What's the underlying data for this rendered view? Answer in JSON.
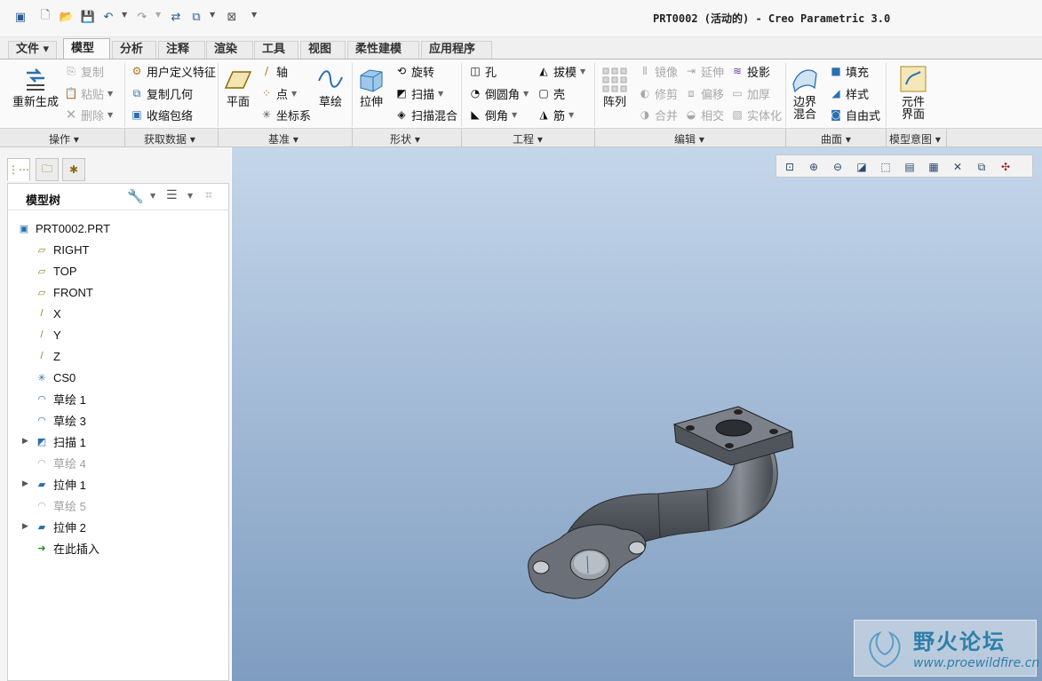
{
  "window": {
    "title": "PRT0002 (活动的) - Creo Parametric 3.0"
  },
  "tabs": [
    {
      "label": "文件 ▾",
      "active": false
    },
    {
      "label": "模型",
      "active": true
    },
    {
      "label": "分析",
      "active": false
    },
    {
      "label": "注释",
      "active": false
    },
    {
      "label": "渲染",
      "active": false
    },
    {
      "label": "工具",
      "active": false
    },
    {
      "label": "视图",
      "active": false
    },
    {
      "label": "柔性建模",
      "active": false
    },
    {
      "label": "应用程序",
      "active": false
    }
  ],
  "ribbon": {
    "regenerate": "重新生成",
    "copy": "复制",
    "paste": "粘贴",
    "delete": "删除",
    "udf": "用户定义特征",
    "copy_geometry": "复制几何",
    "shrinkwrap": "收缩包络",
    "plane": "平面",
    "axis": "轴",
    "point": "点",
    "csys": "坐标系",
    "sketch": "草绘",
    "extrude": "拉伸",
    "revolve": "旋转",
    "sweep": "扫描",
    "swept_blend": "扫描混合",
    "hole": "孔",
    "round": "倒圆角",
    "chamfer": "倒角",
    "draft": "拔模",
    "shell": "壳",
    "rib": "筋",
    "pattern": "阵列",
    "mirror": "镜像",
    "trim": "修剪",
    "merge": "合并",
    "extend": "延伸",
    "offset": "偏移",
    "intersect": "相交",
    "project": "投影",
    "thicken": "加厚",
    "solidify": "实体化",
    "boundary_blend_1": "边界",
    "boundary_blend_2": "混合",
    "fill": "填充",
    "style": "样式",
    "freestyle": "自由式",
    "component_interface_1": "元件",
    "component_interface_2": "界面"
  },
  "groups": [
    {
      "label": "操作 ▾"
    },
    {
      "label": "获取数据 ▾"
    },
    {
      "label": "基准 ▾"
    },
    {
      "label": "形状 ▾"
    },
    {
      "label": "工程 ▾"
    },
    {
      "label": "编辑 ▾"
    },
    {
      "label": "曲面 ▾"
    },
    {
      "label": "模型意图 ▾"
    }
  ],
  "model_tree": {
    "title": "模型树",
    "nodes": [
      {
        "label": "PRT0002.PRT",
        "icon": "part-icon",
        "dim": false,
        "expandable": false
      },
      {
        "label": "RIGHT",
        "icon": "datum-plane-icon",
        "dim": false,
        "expandable": false
      },
      {
        "label": "TOP",
        "icon": "datum-plane-icon",
        "dim": false,
        "expandable": false
      },
      {
        "label": "FRONT",
        "icon": "datum-plane-icon",
        "dim": false,
        "expandable": false
      },
      {
        "label": "X",
        "icon": "datum-axis-icon",
        "dim": false,
        "expandable": false
      },
      {
        "label": "Y",
        "icon": "datum-axis-icon",
        "dim": false,
        "expandable": false
      },
      {
        "label": "Z",
        "icon": "datum-axis-icon",
        "dim": false,
        "expandable": false
      },
      {
        "label": "CS0",
        "icon": "csys-icon",
        "dim": false,
        "expandable": false
      },
      {
        "label": "草绘 1",
        "icon": "sketch-icon",
        "dim": false,
        "expandable": false
      },
      {
        "label": "草绘 3",
        "icon": "sketch-icon",
        "dim": false,
        "expandable": false
      },
      {
        "label": "扫描 1",
        "icon": "sweep-icon",
        "dim": false,
        "expandable": true
      },
      {
        "label": "草绘 4",
        "icon": "sketch-icon",
        "dim": true,
        "expandable": false
      },
      {
        "label": "拉伸 1",
        "icon": "extrude-icon",
        "dim": false,
        "expandable": true
      },
      {
        "label": "草绘 5",
        "icon": "sketch-icon",
        "dim": true,
        "expandable": false
      },
      {
        "label": "拉伸 2",
        "icon": "extrude-icon",
        "dim": false,
        "expandable": true
      },
      {
        "label": "在此插入",
        "icon": "insert-here-icon",
        "dim": false,
        "expandable": false
      }
    ]
  },
  "watermark": {
    "name": "野火论坛",
    "url": "www.proewildfire.cn"
  },
  "colors": {
    "accent": "#2a6fb0",
    "viewport_top": "#c4d6ea",
    "viewport_bottom": "#7f9dc0",
    "part": "#5b6066"
  }
}
